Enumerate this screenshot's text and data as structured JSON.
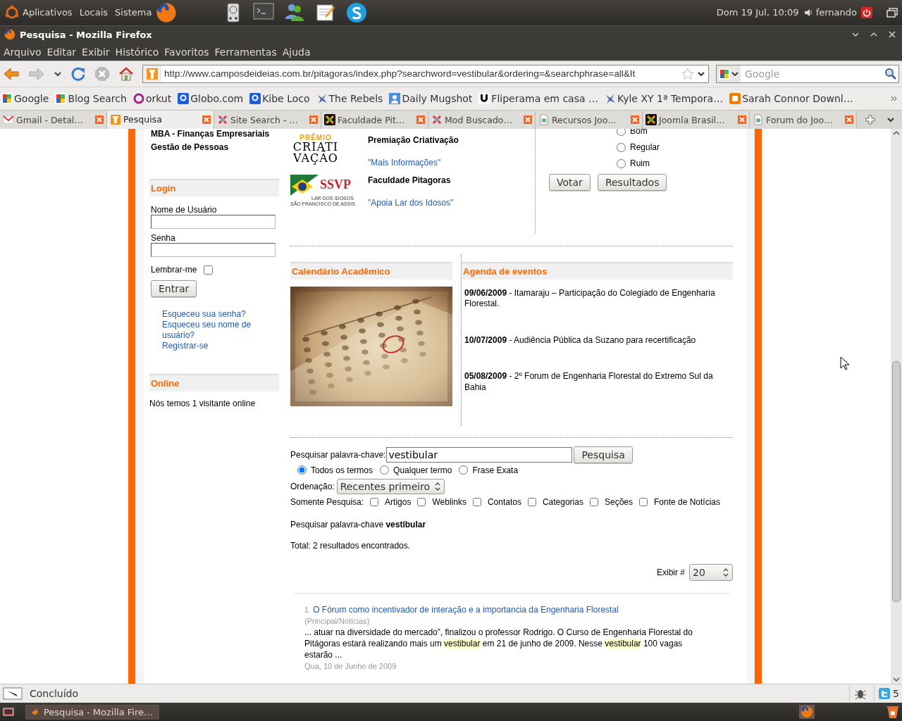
{
  "top_panel": {
    "menus": [
      "Aplicativos",
      "Locais",
      "Sistema"
    ],
    "clock": "Dom 19 Jul, 10:09",
    "user": "fernando"
  },
  "window": {
    "title": "Pesquisa - Mozilla Firefox"
  },
  "menubar": [
    "Arquivo",
    "Editar",
    "Exibir",
    "Histórico",
    "Favoritos",
    "Ferramentas",
    "Ajuda"
  ],
  "address": {
    "url": "http://www.camposdeideias.com.br/pitagoras/index.php?searchword=vestibular&ordering=&searchphrase=all&It"
  },
  "search_box": {
    "placeholder": "Google"
  },
  "bookmarks": [
    {
      "label": "Google",
      "kind": "google"
    },
    {
      "label": "Blog Search",
      "kind": "google"
    },
    {
      "label": "orkut",
      "kind": "orkut"
    },
    {
      "label": "Globo.com",
      "kind": "globo"
    },
    {
      "label": "Kibe Loco",
      "kind": "globo"
    },
    {
      "label": "The Rebels",
      "kind": "splat"
    },
    {
      "label": "Daily Mugshot",
      "kind": "person"
    },
    {
      "label": "Fliperama em casa …",
      "kind": "horseshoe"
    },
    {
      "label": "Kyle XY 1ª Tempora…",
      "kind": "splat"
    },
    {
      "label": "Sarah Connor Downl…",
      "kind": "blogger"
    }
  ],
  "tabs": [
    {
      "label": "Gmail - Detal…",
      "kind": "mail",
      "selected": false
    },
    {
      "label": "Pesquisa",
      "kind": "figure",
      "selected": true
    },
    {
      "label": "Site Search - …",
      "kind": "knot",
      "selected": false
    },
    {
      "label": "Faculdade Pit…",
      "kind": "knot-dark",
      "selected": false
    },
    {
      "label": "Mod Buscado…",
      "kind": "knot",
      "selected": false
    },
    {
      "label": "Recursos Joo…",
      "kind": "page",
      "selected": false
    },
    {
      "label": "Joomla Brasil…",
      "kind": "knot-dark",
      "selected": false
    },
    {
      "label": "Forum do Joo…",
      "kind": "page",
      "selected": false
    }
  ],
  "page": {
    "left": {
      "cut_item": "MBA - Finanças Empresariais",
      "item": "Gestão de Pessoas",
      "login": {
        "title": "Login",
        "username_label": "Nome de Usuário",
        "password_label": "Senha",
        "remember_label": "Lembrar-me",
        "remember": false,
        "submit": "Entrar",
        "links": [
          "Esqueceu sua senha?",
          "Esqueceu seu nome de usuário?",
          "Registrar-se"
        ]
      },
      "online": {
        "title": "Online",
        "text": "Nós temos 1 visitante online"
      }
    },
    "banners": [
      {
        "kind": "criativacao",
        "logo_texts": [
          "PRÊMIO",
          "CRIATI",
          "VAÇÃO"
        ],
        "title": "Premiação Criativação",
        "link": "\"Mais Informações\""
      },
      {
        "kind": "ssvp",
        "logo_texts": [
          "SSVP",
          "LAR DOS IDOSOS",
          "SÃO FRANCISCO DE ASSIS"
        ],
        "title": "Faculdade Pitagoras",
        "link": "\"Apoia Lar dos Idosos\""
      }
    ],
    "poll": {
      "options": [
        {
          "label": "Bom",
          "selected": false
        },
        {
          "label": "Regular",
          "selected": false
        },
        {
          "label": "Ruim",
          "selected": false
        }
      ],
      "buttons": [
        "Votar",
        "Resultados"
      ]
    },
    "calendar": {
      "title": "Calendário Acadêmico"
    },
    "agenda": {
      "title": "Agenda de eventos",
      "events": [
        {
          "date": "09/06/2009",
          "text": " - Itamaraju – Participação do Colegiado de Engenharia Florestal."
        },
        {
          "date": "10/07/2009",
          "text": " - Audiência Pública da Suzano para recertificação"
        },
        {
          "date": "05/08/2009",
          "text": " - 2º Forum de Engenharia Florestal do Extremo Sul da Bahia"
        }
      ]
    },
    "search": {
      "keyword_label": "Pesquisar palavra-chave:",
      "keyword": "vestibular",
      "button": "Pesquisa",
      "phrase_options": [
        {
          "label": "Todos os termos",
          "selected": true
        },
        {
          "label": "Qualquer termo",
          "selected": false
        },
        {
          "label": "Frase Exata",
          "selected": false
        }
      ],
      "ordering_label": "Ordenação:",
      "ordering": "Recentes primeiro",
      "areas_label": "Somente Pesquisa:",
      "areas": [
        {
          "label": "Artigos",
          "checked": false
        },
        {
          "label": "Weblinks",
          "checked": false
        },
        {
          "label": "Contatos",
          "checked": false
        },
        {
          "label": "Categorias",
          "checked": false
        },
        {
          "label": "Seções",
          "checked": false
        },
        {
          "label": "Fonte de Notícias",
          "checked": false
        }
      ],
      "summary": "Pesquisar palavra-chave **vestibular**",
      "total": "Total: 2 resultados encontrados.",
      "limit_label": "Exibir #",
      "limit": "20"
    },
    "results": [
      {
        "number": "1.",
        "title": "O Fórum como incentivador de interação e a importancia da Engenharia Florestal",
        "section": "(Principal/Notícias)",
        "snippet": [
          {
            "text": "... atuar na diversidade do mercado”, finalizou o professor Rodrigo. O Curso de Engenharia Florestal do Pitágoras estará realizando mais um ",
            "highlight": false
          },
          {
            "text": "vestibular",
            "highlight": true
          },
          {
            "text": " em 21 de junho de 2009. Nesse ",
            "highlight": false
          },
          {
            "text": "vestibular",
            "highlight": true
          },
          {
            "text": " 100 vagas estarão ...",
            "highlight": false
          }
        ],
        "date": "Qua, 10 de Junho de 2009"
      }
    ]
  },
  "status_bar": {
    "text": "Concluído",
    "twitter_count": "5"
  },
  "taskbar": [
    {
      "label": "Pesquisa - Mozilla Fire…",
      "selected": true
    }
  ]
}
